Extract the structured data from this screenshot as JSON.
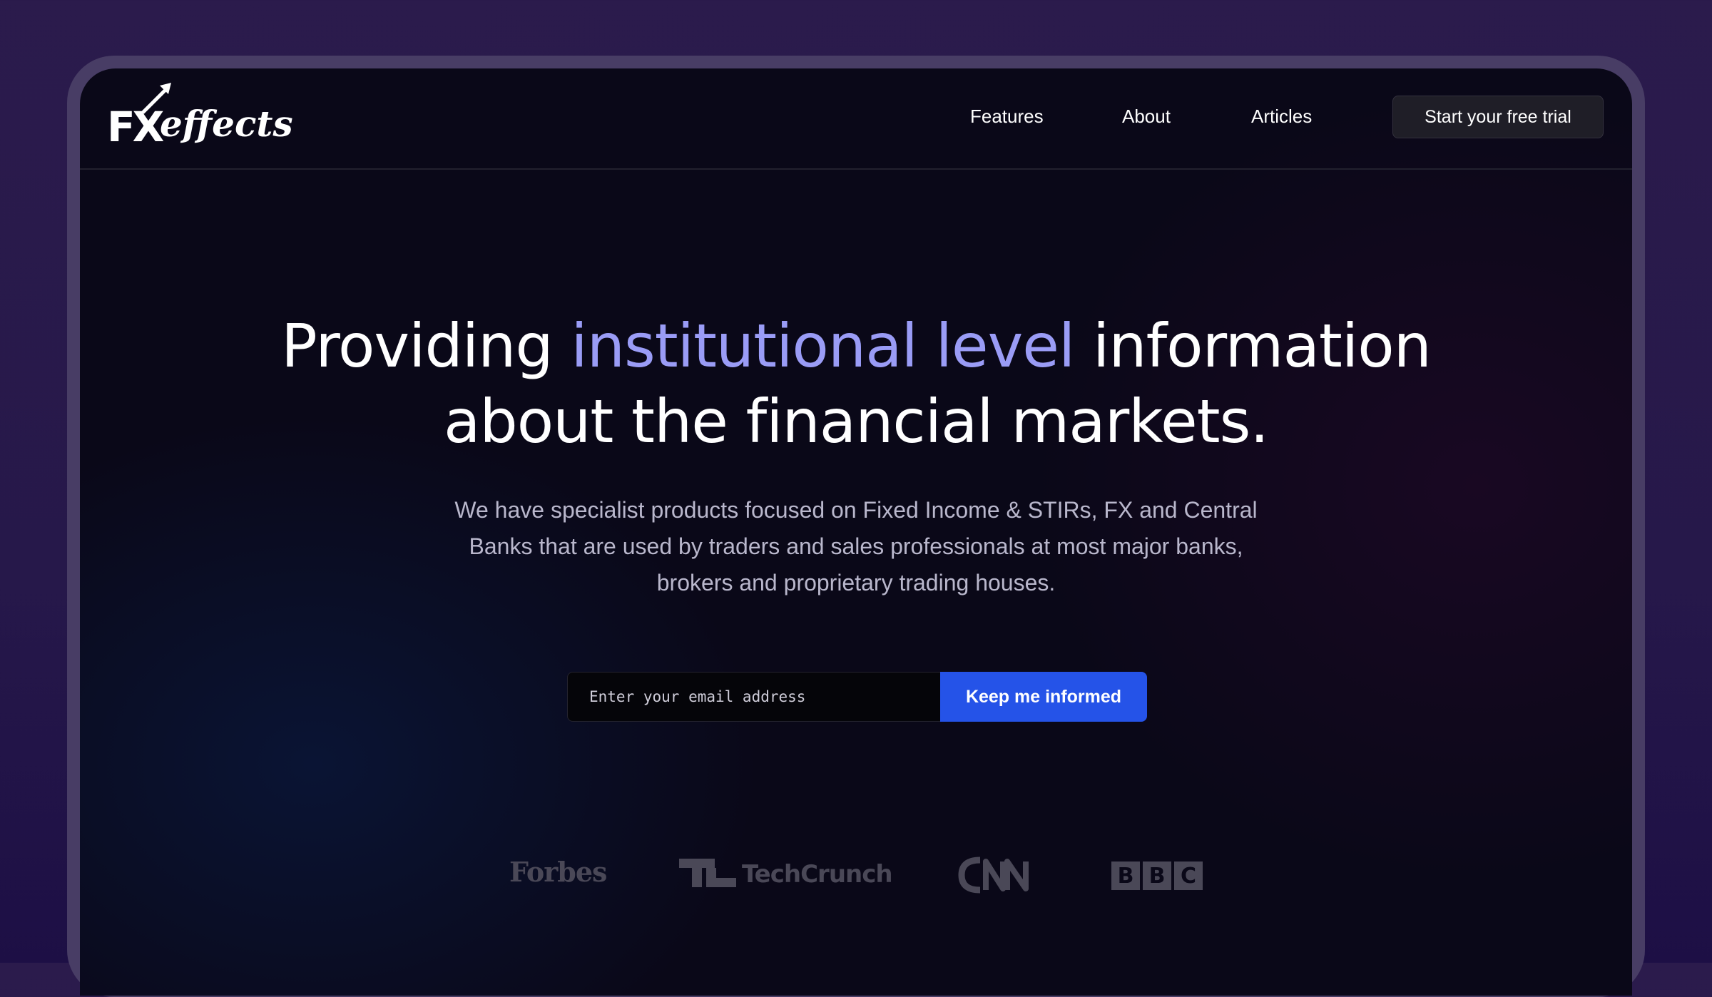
{
  "brand": {
    "logo_fx": "FX",
    "logo_effects": "effects"
  },
  "nav": {
    "links": [
      "Features",
      "About",
      "Articles"
    ],
    "cta_label": "Start your free trial"
  },
  "hero": {
    "headline_part1": "Providing ",
    "headline_highlight": "institutional level",
    "headline_part2": " information",
    "headline_line2": "about the financial markets.",
    "subtext": "We have specialist products focused on Fixed Income & STIRs, FX and Central Banks that are used by traders and sales professionals at most major banks, brokers and proprietary trading houses."
  },
  "signup": {
    "email_placeholder": "Enter your email address",
    "button_label": "Keep me informed"
  },
  "press": {
    "forbes": "Forbes",
    "techcrunch": "TechCrunch",
    "cnn": "CNN",
    "bbc_letters": [
      "B",
      "B",
      "C"
    ]
  },
  "colors": {
    "accent_highlight": "#9a9cf6",
    "button_blue": "#2553e8",
    "logo_muted": "#4a4857"
  }
}
